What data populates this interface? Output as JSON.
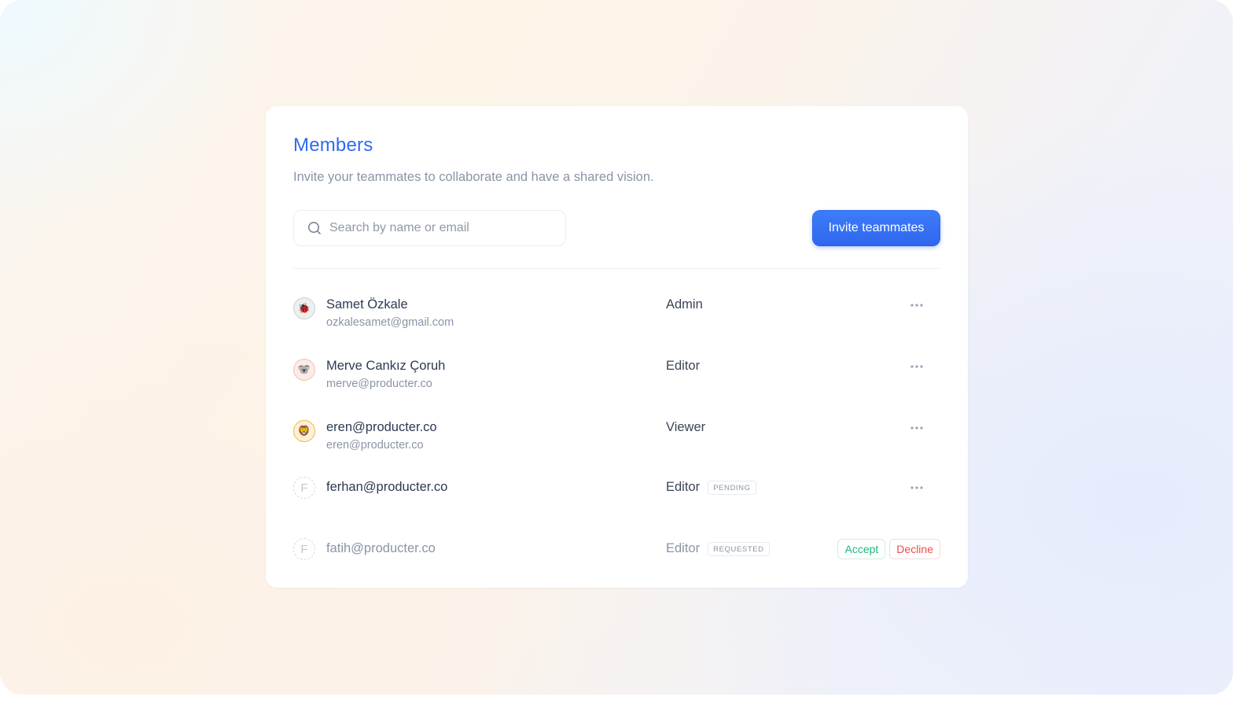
{
  "panel": {
    "title": "Members",
    "subtitle": "Invite your teammates to collaborate and have a shared vision."
  },
  "search": {
    "placeholder": "Search by name or email",
    "value": "",
    "icon": "search-icon"
  },
  "invite_button": {
    "label": "Invite teammates",
    "color": "#2f6bef"
  },
  "members": [
    {
      "name": "Samet Özkale",
      "email": "ozkalesamet@gmail.com",
      "role": "Admin",
      "avatar": "🐞"
    },
    {
      "name": "Merve Cankız Çoruh",
      "email": "merve@producter.co",
      "role": "Editor",
      "avatar": "🐨"
    },
    {
      "name": "eren@producter.co",
      "email": "eren@producter.co",
      "role": "Viewer",
      "avatar": "🦁"
    },
    {
      "name": "ferhan@producter.co",
      "role": "Editor",
      "avatar": "F",
      "badge": "PENDING"
    },
    {
      "name": "fatih@producter.co",
      "role": "Editor",
      "avatar": "F",
      "badge": "REQUESTED"
    }
  ],
  "request_actions": {
    "accept_label": "Accept",
    "decline_label": "Decline"
  },
  "colors": {
    "accent": "#2f6bef",
    "accept": "#1eb97c",
    "decline": "#ef4b4b"
  }
}
